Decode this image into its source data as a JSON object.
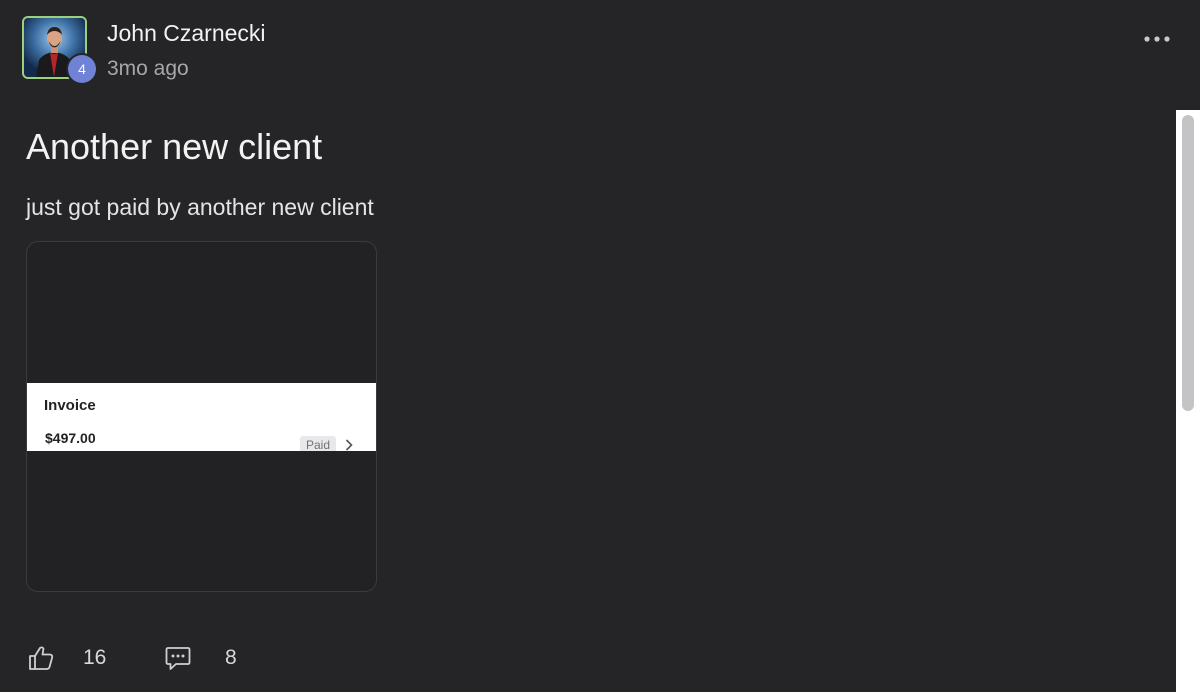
{
  "post": {
    "author": {
      "name": "John Czarnecki",
      "level": "4",
      "avatar": "avatar-photo"
    },
    "timestamp": "3mo ago",
    "title": "Another new client",
    "body": "just got paid by another new client",
    "attachment": {
      "label": "Invoice",
      "amount": "$497.00",
      "status": "Paid"
    },
    "actions": {
      "likes": "16",
      "comments": "8"
    }
  },
  "icons": {
    "more": "more-horizontal-icon",
    "like": "thumbs-up-icon",
    "comment": "comment-icon",
    "chevron": "chevron-right-icon"
  },
  "colors": {
    "background": "#252527",
    "avatar_border": "#9bd07c",
    "level_badge": "#6f82d6",
    "primary_text": "#f2f2f2",
    "secondary_text": "#a7a7a9"
  },
  "scroll": {
    "position": 0
  }
}
